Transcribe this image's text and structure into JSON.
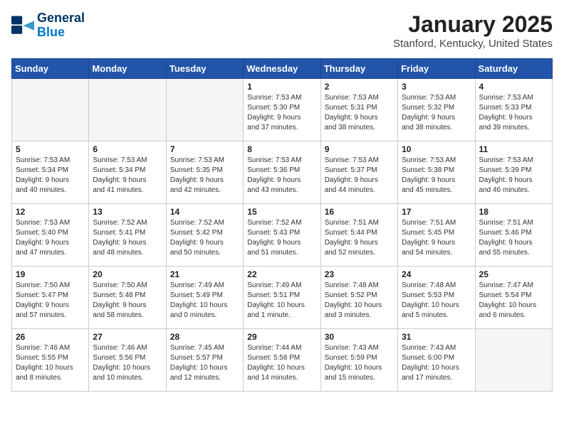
{
  "logo": {
    "line1": "General",
    "line2": "Blue"
  },
  "title": "January 2025",
  "location": "Stanford, Kentucky, United States",
  "weekdays": [
    "Sunday",
    "Monday",
    "Tuesday",
    "Wednesday",
    "Thursday",
    "Friday",
    "Saturday"
  ],
  "weeks": [
    [
      {
        "day": "",
        "details": ""
      },
      {
        "day": "",
        "details": ""
      },
      {
        "day": "",
        "details": ""
      },
      {
        "day": "1",
        "details": "Sunrise: 7:53 AM\nSunset: 5:30 PM\nDaylight: 9 hours\nand 37 minutes."
      },
      {
        "day": "2",
        "details": "Sunrise: 7:53 AM\nSunset: 5:31 PM\nDaylight: 9 hours\nand 38 minutes."
      },
      {
        "day": "3",
        "details": "Sunrise: 7:53 AM\nSunset: 5:32 PM\nDaylight: 9 hours\nand 38 minutes."
      },
      {
        "day": "4",
        "details": "Sunrise: 7:53 AM\nSunset: 5:33 PM\nDaylight: 9 hours\nand 39 minutes."
      }
    ],
    [
      {
        "day": "5",
        "details": "Sunrise: 7:53 AM\nSunset: 5:34 PM\nDaylight: 9 hours\nand 40 minutes."
      },
      {
        "day": "6",
        "details": "Sunrise: 7:53 AM\nSunset: 5:34 PM\nDaylight: 9 hours\nand 41 minutes."
      },
      {
        "day": "7",
        "details": "Sunrise: 7:53 AM\nSunset: 5:35 PM\nDaylight: 9 hours\nand 42 minutes."
      },
      {
        "day": "8",
        "details": "Sunrise: 7:53 AM\nSunset: 5:36 PM\nDaylight: 9 hours\nand 43 minutes."
      },
      {
        "day": "9",
        "details": "Sunrise: 7:53 AM\nSunset: 5:37 PM\nDaylight: 9 hours\nand 44 minutes."
      },
      {
        "day": "10",
        "details": "Sunrise: 7:53 AM\nSunset: 5:38 PM\nDaylight: 9 hours\nand 45 minutes."
      },
      {
        "day": "11",
        "details": "Sunrise: 7:53 AM\nSunset: 5:39 PM\nDaylight: 9 hours\nand 46 minutes."
      }
    ],
    [
      {
        "day": "12",
        "details": "Sunrise: 7:53 AM\nSunset: 5:40 PM\nDaylight: 9 hours\nand 47 minutes."
      },
      {
        "day": "13",
        "details": "Sunrise: 7:52 AM\nSunset: 5:41 PM\nDaylight: 9 hours\nand 48 minutes."
      },
      {
        "day": "14",
        "details": "Sunrise: 7:52 AM\nSunset: 5:42 PM\nDaylight: 9 hours\nand 50 minutes."
      },
      {
        "day": "15",
        "details": "Sunrise: 7:52 AM\nSunset: 5:43 PM\nDaylight: 9 hours\nand 51 minutes."
      },
      {
        "day": "16",
        "details": "Sunrise: 7:51 AM\nSunset: 5:44 PM\nDaylight: 9 hours\nand 52 minutes."
      },
      {
        "day": "17",
        "details": "Sunrise: 7:51 AM\nSunset: 5:45 PM\nDaylight: 9 hours\nand 54 minutes."
      },
      {
        "day": "18",
        "details": "Sunrise: 7:51 AM\nSunset: 5:46 PM\nDaylight: 9 hours\nand 55 minutes."
      }
    ],
    [
      {
        "day": "19",
        "details": "Sunrise: 7:50 AM\nSunset: 5:47 PM\nDaylight: 9 hours\nand 57 minutes."
      },
      {
        "day": "20",
        "details": "Sunrise: 7:50 AM\nSunset: 5:48 PM\nDaylight: 9 hours\nand 58 minutes."
      },
      {
        "day": "21",
        "details": "Sunrise: 7:49 AM\nSunset: 5:49 PM\nDaylight: 10 hours\nand 0 minutes."
      },
      {
        "day": "22",
        "details": "Sunrise: 7:49 AM\nSunset: 5:51 PM\nDaylight: 10 hours\nand 1 minute."
      },
      {
        "day": "23",
        "details": "Sunrise: 7:48 AM\nSunset: 5:52 PM\nDaylight: 10 hours\nand 3 minutes."
      },
      {
        "day": "24",
        "details": "Sunrise: 7:48 AM\nSunset: 5:53 PM\nDaylight: 10 hours\nand 5 minutes."
      },
      {
        "day": "25",
        "details": "Sunrise: 7:47 AM\nSunset: 5:54 PM\nDaylight: 10 hours\nand 6 minutes."
      }
    ],
    [
      {
        "day": "26",
        "details": "Sunrise: 7:46 AM\nSunset: 5:55 PM\nDaylight: 10 hours\nand 8 minutes."
      },
      {
        "day": "27",
        "details": "Sunrise: 7:46 AM\nSunset: 5:56 PM\nDaylight: 10 hours\nand 10 minutes."
      },
      {
        "day": "28",
        "details": "Sunrise: 7:45 AM\nSunset: 5:57 PM\nDaylight: 10 hours\nand 12 minutes."
      },
      {
        "day": "29",
        "details": "Sunrise: 7:44 AM\nSunset: 5:58 PM\nDaylight: 10 hours\nand 14 minutes."
      },
      {
        "day": "30",
        "details": "Sunrise: 7:43 AM\nSunset: 5:59 PM\nDaylight: 10 hours\nand 15 minutes."
      },
      {
        "day": "31",
        "details": "Sunrise: 7:43 AM\nSunset: 6:00 PM\nDaylight: 10 hours\nand 17 minutes."
      },
      {
        "day": "",
        "details": ""
      }
    ]
  ]
}
